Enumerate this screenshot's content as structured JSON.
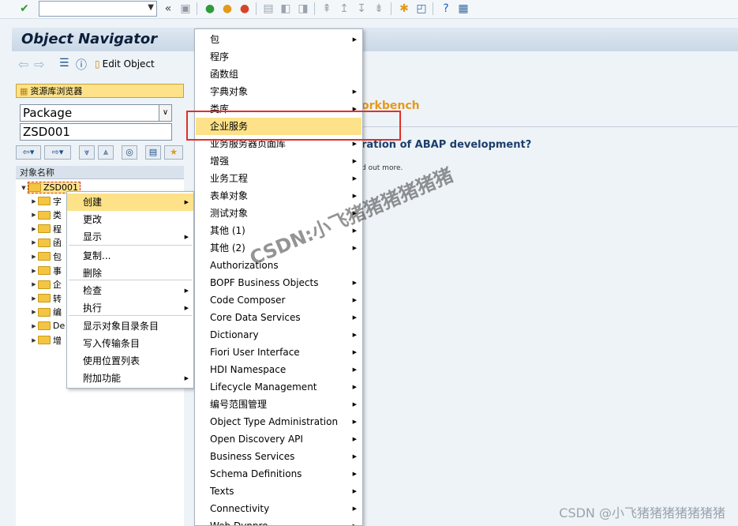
{
  "window": {
    "title": "Object Navigator",
    "edit_object": "Edit Object"
  },
  "left_panel": {
    "repo_browser": "资源库浏览器",
    "object_type": "Package",
    "object_name": "ZSD001",
    "tree_header": "对象名称",
    "root": "ZSD001",
    "children": [
      "字",
      "类",
      "程",
      "函",
      "包",
      "事",
      "企",
      "转",
      "编",
      "De",
      "增"
    ]
  },
  "content": {
    "heading": "orkbench",
    "question": "ration of ABAP development?",
    "small": "d out more."
  },
  "context_menu": {
    "items": [
      {
        "label": "创建",
        "arrow": true,
        "highlight": true
      },
      {
        "label": "更改",
        "arrow": false
      },
      {
        "label": "显示",
        "arrow": true
      },
      {
        "label": "复制...",
        "arrow": false
      },
      {
        "label": "删除",
        "arrow": false
      },
      {
        "label": "检查",
        "arrow": true
      },
      {
        "label": "执行",
        "arrow": true
      },
      {
        "label": "显示对象目录条目",
        "arrow": false
      },
      {
        "label": "写入传输条目",
        "arrow": false
      },
      {
        "label": "使用位置列表",
        "arrow": false
      },
      {
        "label": "附加功能",
        "arrow": true
      }
    ]
  },
  "submenu": {
    "items": [
      {
        "label": "包",
        "arrow": true
      },
      {
        "label": "程序",
        "arrow": false
      },
      {
        "label": "函数组",
        "arrow": false
      },
      {
        "label": "字典对象",
        "arrow": true
      },
      {
        "label": "类库",
        "arrow": true
      },
      {
        "label": "企业服务",
        "arrow": false,
        "highlight": true
      },
      {
        "label": "业务服务器页面库",
        "arrow": true
      },
      {
        "label": "增强",
        "arrow": true
      },
      {
        "label": "业务工程",
        "arrow": true
      },
      {
        "label": "表单对象",
        "arrow": true
      },
      {
        "label": "测试对象",
        "arrow": true
      },
      {
        "label": "其他 (1)",
        "arrow": true
      },
      {
        "label": "其他 (2)",
        "arrow": true
      },
      {
        "label": "Authorizations",
        "arrow": false
      },
      {
        "label": "BOPF Business Objects",
        "arrow": true
      },
      {
        "label": "Code Composer",
        "arrow": true
      },
      {
        "label": "Core Data Services",
        "arrow": true
      },
      {
        "label": "Dictionary",
        "arrow": true
      },
      {
        "label": "Fiori User Interface",
        "arrow": true
      },
      {
        "label": "HDI Namespace",
        "arrow": true
      },
      {
        "label": "Lifecycle Management",
        "arrow": true
      },
      {
        "label": "编号范围管理",
        "arrow": true
      },
      {
        "label": "Object Type Administration",
        "arrow": true
      },
      {
        "label": "Open Discovery API",
        "arrow": true
      },
      {
        "label": "Business Services",
        "arrow": true
      },
      {
        "label": "Schema Definitions",
        "arrow": true
      },
      {
        "label": "Texts",
        "arrow": true
      },
      {
        "label": "Connectivity",
        "arrow": true
      },
      {
        "label": "Web Dynpro",
        "arrow": true
      }
    ]
  },
  "watermark": "CSDN:小飞猪猪猪猪猪猪",
  "credit": "CSDN @小飞猪猪猪猪猪猪猪",
  "icons": {
    "ok": "check-circle-icon",
    "dropdown": "chevron-down-icon"
  }
}
